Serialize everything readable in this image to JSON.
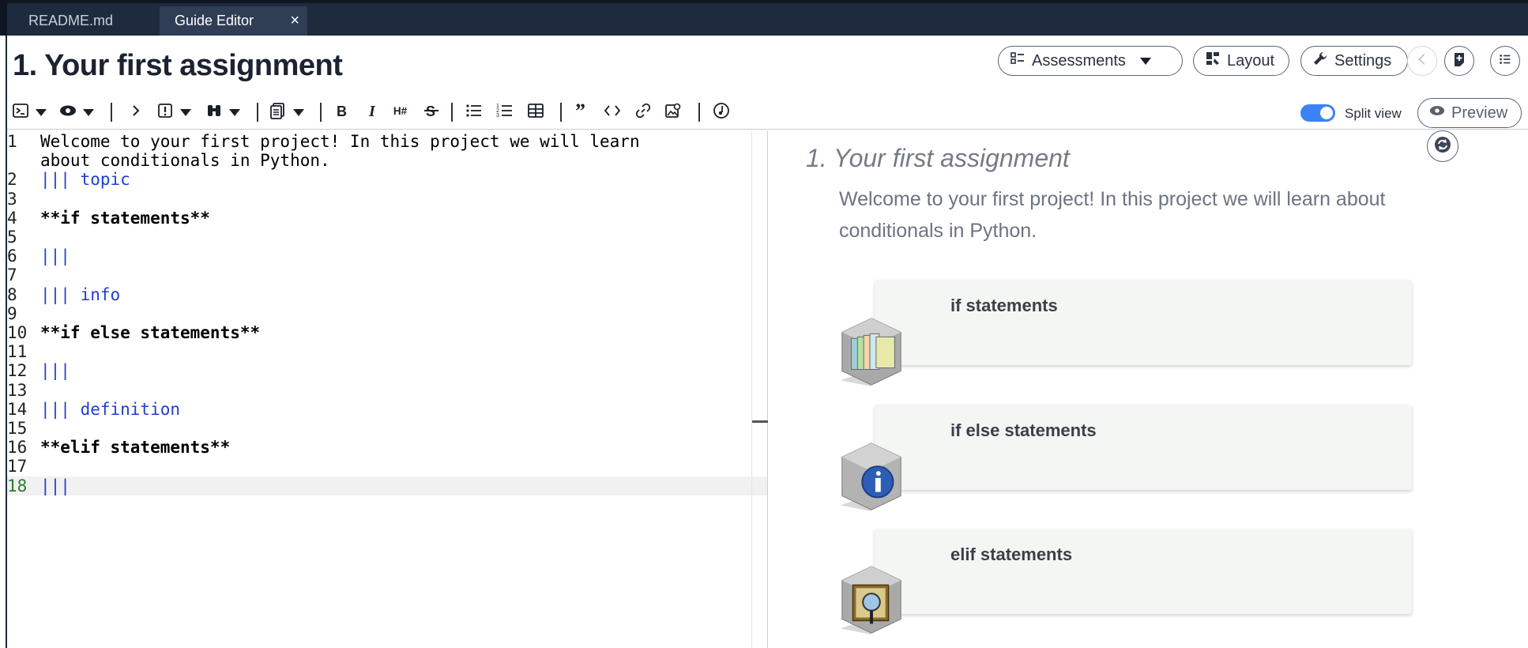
{
  "tabs": [
    {
      "label": "README.md",
      "active": false
    },
    {
      "label": "Guide Editor",
      "active": true,
      "close": "×"
    }
  ],
  "header": {
    "title": "1. Your first assignment",
    "assessments_label": "Assessments",
    "layout_label": "Layout",
    "settings_label": "Settings"
  },
  "toolbar": {
    "split_view_label": "Split view",
    "split_view_on": true,
    "preview_label": "Preview",
    "buttons": [
      "terminal-icon",
      "eye-icon",
      "chevron-right-icon",
      "alert-icon",
      "binoculars-icon",
      "file-copy-icon",
      "bold-icon",
      "italic-icon",
      "heading-icon",
      "strikethrough-icon",
      "bullet-list-icon",
      "numbered-list-icon",
      "table-icon",
      "quote-icon",
      "code-icon",
      "link-icon",
      "image-icon",
      "music-icon"
    ]
  },
  "editor": {
    "lines": [
      {
        "n": "1",
        "text": "Welcome to your first project! In this project we will learn",
        "style": "plain"
      },
      {
        "n": "",
        "text": "about conditionals in Python.",
        "style": "plain"
      },
      {
        "n": "2",
        "text": "||| topic",
        "style": "blue"
      },
      {
        "n": "3",
        "text": "",
        "style": "plain"
      },
      {
        "n": "4",
        "text": "**if statements**",
        "style": "bold"
      },
      {
        "n": "5",
        "text": "",
        "style": "plain"
      },
      {
        "n": "6",
        "text": "|||",
        "style": "blue"
      },
      {
        "n": "7",
        "text": "",
        "style": "plain"
      },
      {
        "n": "8",
        "text": "||| info",
        "style": "blue"
      },
      {
        "n": "9",
        "text": "",
        "style": "plain"
      },
      {
        "n": "10",
        "text": "**if else statements**",
        "style": "bold"
      },
      {
        "n": "11",
        "text": "",
        "style": "plain"
      },
      {
        "n": "12",
        "text": "|||",
        "style": "blue"
      },
      {
        "n": "13",
        "text": "",
        "style": "plain"
      },
      {
        "n": "14",
        "text": "||| definition",
        "style": "blue"
      },
      {
        "n": "15",
        "text": "",
        "style": "plain"
      },
      {
        "n": "16",
        "text": "**elif statements**",
        "style": "bold"
      },
      {
        "n": "17",
        "text": "",
        "style": "plain"
      },
      {
        "n": "18",
        "text": "|||",
        "style": "blue"
      }
    ]
  },
  "preview": {
    "title": "1. Your first assignment",
    "intro": "Welcome to your first project! In this project we will learn about conditionals in Python.",
    "cards": [
      {
        "title": "if statements",
        "icon": "topic-folders-icon"
      },
      {
        "title": "if else statements",
        "icon": "info-icon"
      },
      {
        "title": "elif statements",
        "icon": "definition-book-icon"
      }
    ]
  },
  "colors": {
    "tabbar": "#1e2a3e",
    "accent": "#3b82f6",
    "directive": "#1f3fd1"
  }
}
